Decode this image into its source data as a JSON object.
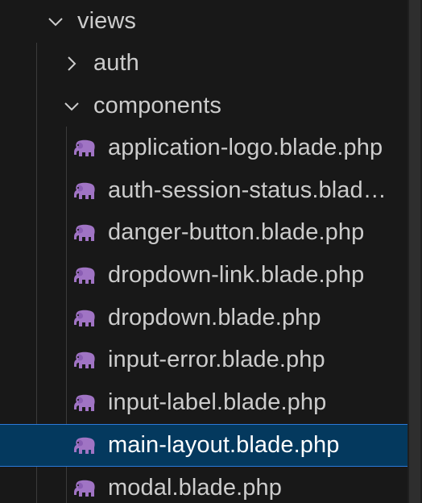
{
  "explorer": {
    "folders": {
      "views": {
        "label": "views",
        "expanded": true
      },
      "auth": {
        "label": "auth",
        "expanded": false
      },
      "components": {
        "label": "components",
        "expanded": true
      }
    },
    "files": [
      {
        "label": "application-logo.blade.php",
        "icon": "php-elephant-icon"
      },
      {
        "label": "auth-session-status.blad…",
        "icon": "php-elephant-icon"
      },
      {
        "label": "danger-button.blade.php",
        "icon": "php-elephant-icon"
      },
      {
        "label": "dropdown-link.blade.php",
        "icon": "php-elephant-icon"
      },
      {
        "label": "dropdown.blade.php",
        "icon": "php-elephant-icon"
      },
      {
        "label": "input-error.blade.php",
        "icon": "php-elephant-icon"
      },
      {
        "label": "input-label.blade.php",
        "icon": "php-elephant-icon"
      },
      {
        "label": "main-layout.blade.php",
        "icon": "php-elephant-icon",
        "selected": true
      },
      {
        "label": "modal.blade.php",
        "icon": "php-elephant-icon"
      }
    ],
    "colors": {
      "background": "#181818",
      "selection": "#04395e",
      "selection_border": "#2b79d8",
      "icon": "#a074c4",
      "text": "#cccccc"
    }
  }
}
